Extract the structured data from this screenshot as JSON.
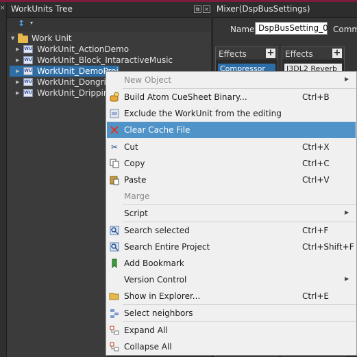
{
  "workunits_tree": {
    "title": "WorkUnits Tree",
    "close_glyph": "×",
    "root": {
      "label": "Work Unit",
      "icon": "folder-icon"
    },
    "items": [
      {
        "label": "WorkUnit_ActionDemo"
      },
      {
        "label": "WorkUnit_Block_IntaractiveMusic"
      },
      {
        "label": "WorkUnit_DemoProj",
        "selected": true
      },
      {
        "label": "WorkUnit_Dongri"
      },
      {
        "label": "WorkUnit_Dripping"
      }
    ],
    "sort_glyph": "↕",
    "sort_caret": "▾",
    "wu_badge": "WU"
  },
  "mixer": {
    "title": "Mixer(DspBusSettings)",
    "name_label": "Name",
    "name_value": "DspBusSetting_0",
    "comment_label": "Comm",
    "effects": [
      {
        "title": "Effects",
        "add": "+",
        "item": "Compressor"
      },
      {
        "title": "Effects",
        "add": "+",
        "item": "I3DL2 Reverb"
      }
    ]
  },
  "context_menu": {
    "items": [
      {
        "label": "New Object",
        "shortcut": "",
        "submenu": true,
        "disabled": true,
        "icon": ""
      },
      {
        "label": "Build Atom CueSheet Binary...",
        "shortcut": "Ctrl+B",
        "icon": "build-icon"
      },
      {
        "label": "Exclude the WorkUnit from the editing",
        "shortcut": "",
        "icon": "exclude-icon"
      },
      {
        "label": "Clear Cache File",
        "shortcut": "",
        "icon": "clear-x-icon",
        "highlighted": true
      },
      {
        "label": "Cut",
        "shortcut": "Ctrl+X",
        "icon": "scissors-icon"
      },
      {
        "label": "Copy",
        "shortcut": "Ctrl+C",
        "icon": "copy-icon"
      },
      {
        "label": "Paste",
        "shortcut": "Ctrl+V",
        "icon": "paste-icon"
      },
      {
        "label": "Marge",
        "shortcut": "",
        "disabled": true,
        "icon": ""
      },
      {
        "label": "Script",
        "shortcut": "",
        "submenu": true,
        "icon": ""
      },
      {
        "label": "Search selected",
        "shortcut": "Ctrl+F",
        "icon": "search-icon"
      },
      {
        "label": "Search Entire Project",
        "shortcut": "Ctrl+Shift+F",
        "icon": "search-project-icon"
      },
      {
        "label": "Add Bookmark",
        "shortcut": "",
        "icon": "bookmark-icon"
      },
      {
        "label": "Version Control",
        "shortcut": "",
        "submenu": true,
        "icon": ""
      },
      {
        "label": "Show in Explorer...",
        "shortcut": "Ctrl+E",
        "icon": "folder-open-icon"
      },
      {
        "label": "Select neighbors",
        "shortcut": "",
        "icon": "neighbors-icon"
      },
      {
        "label": "Expand All",
        "shortcut": "",
        "icon": "expand-icon"
      },
      {
        "label": "Collapse All",
        "shortcut": "",
        "icon": "collapse-icon"
      }
    ],
    "submenu_glyph": "▶"
  },
  "colors": {
    "highlight": "#4f93c8",
    "selection": "#2e6ea6",
    "accent_strip": "#7a1c3a"
  }
}
